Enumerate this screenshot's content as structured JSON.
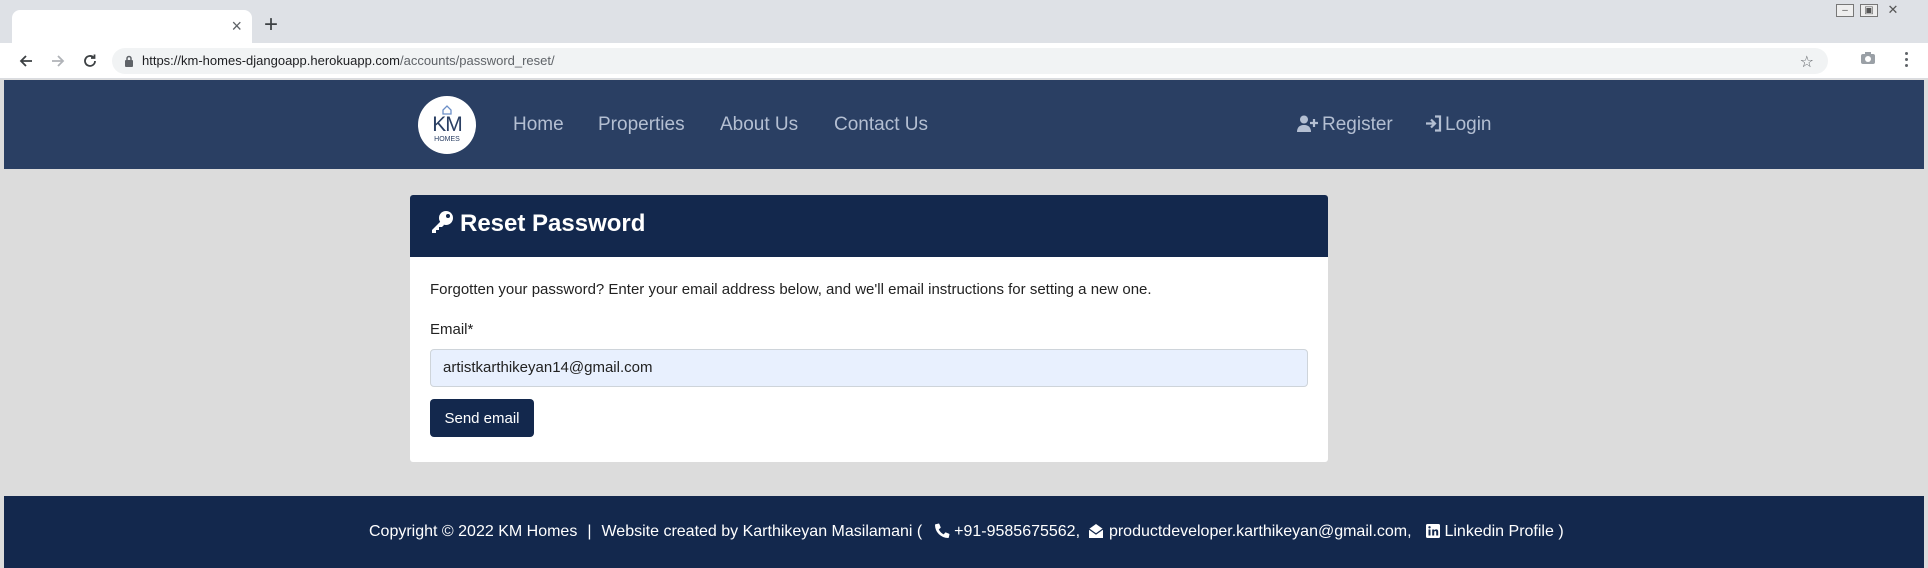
{
  "browser": {
    "new_tab": "+",
    "tab_close": "×",
    "url_host": "https://km-homes-djangoapp.herokuapp.com",
    "url_path": "/accounts/password_reset/",
    "icons": [
      "back-arrow-icon",
      "forward-arrow-icon",
      "reload-icon",
      "lock-icon",
      "star-icon",
      "camera-icon",
      "menu-dots-icon"
    ]
  },
  "navbar": {
    "logo_text": "KM",
    "logo_subtext": "HOMES",
    "links": [
      "Home",
      "Properties",
      "About Us",
      "Contact Us"
    ],
    "register": "Register",
    "login": "Login",
    "colors": {
      "background": "#2a3f63",
      "link": "#b4bfd2"
    }
  },
  "reset_card": {
    "title": "Reset Password",
    "intro": "Forgotten your password? Enter your email address below, and we'll email instructions for setting a new one.",
    "email_label": "Email*",
    "email_value": "artistkarthikeyan14@gmail.com",
    "submit_label": "Send email",
    "colors": {
      "header": "#13284d",
      "input_bg": "#e8f0fe"
    }
  },
  "footer": {
    "copyright": "Copyright © 2022 KM Homes",
    "separator": "|",
    "credit_prefix": "Website created by Karthikeyan Masilamani (",
    "phone": "+91-9585675562,",
    "email": "productdeveloper.karthikeyan@gmail.com,",
    "linkedin": "Linkedin Profile",
    "credit_suffix": ")"
  }
}
